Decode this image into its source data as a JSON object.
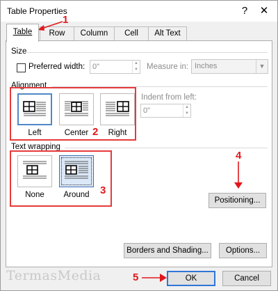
{
  "window": {
    "title": "Table Properties",
    "help_glyph": "?",
    "close_glyph": "✕"
  },
  "tabs": [
    {
      "label": "Table",
      "active": true
    },
    {
      "label": "Row",
      "active": false
    },
    {
      "label": "Column",
      "active": false
    },
    {
      "label": "Cell",
      "active": false
    },
    {
      "label": "Alt Text",
      "active": false
    }
  ],
  "size": {
    "heading": "Size",
    "preferred_width_label": "Preferred width:",
    "preferred_width_checked": false,
    "preferred_width_value": "0\"",
    "measure_in_label": "Measure in:",
    "measure_in_value": "Inches"
  },
  "alignment": {
    "heading": "Alignment",
    "options": [
      {
        "label": "Left",
        "selected": true
      },
      {
        "label": "Center",
        "selected": false
      },
      {
        "label": "Right",
        "selected": false
      }
    ],
    "indent_label": "Indent from left:",
    "indent_value": "0\""
  },
  "text_wrapping": {
    "heading": "Text wrapping",
    "options": [
      {
        "label": "None",
        "selected": false
      },
      {
        "label": "Around",
        "selected": true
      }
    ],
    "positioning_button": "Positioning..."
  },
  "bottom_buttons": {
    "borders_shading": "Borders and Shading...",
    "options": "Options...",
    "ok": "OK",
    "cancel": "Cancel"
  },
  "annotations": [
    "1",
    "2",
    "3",
    "4",
    "5"
  ],
  "watermark": "TermasMedia",
  "colors": {
    "annotation_red": "#e0181c",
    "selection_blue": "#4f88c9",
    "default_button_border": "#2f76d6"
  }
}
